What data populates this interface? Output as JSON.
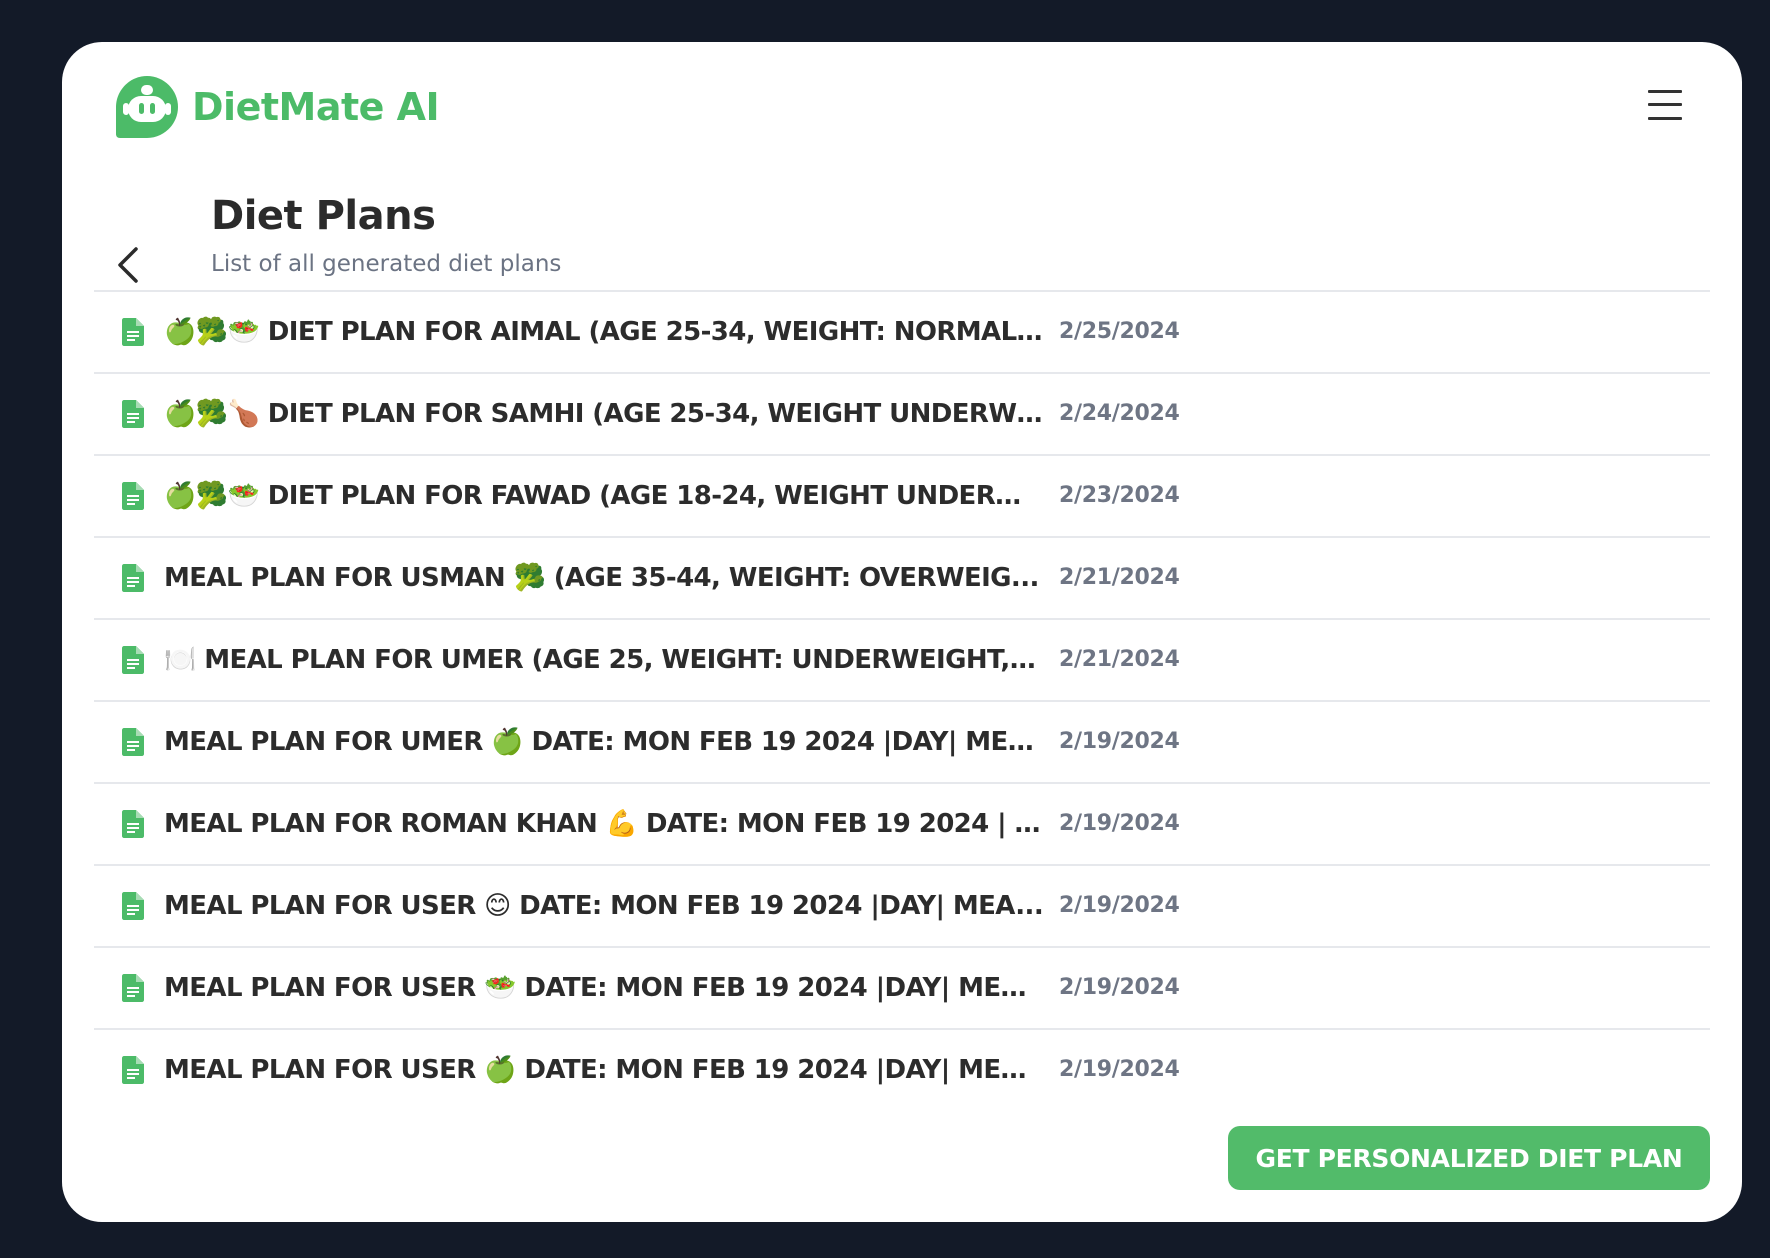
{
  "colors": {
    "brand": "#4cbb68",
    "button": "#52bb6a",
    "background": "#131a28",
    "card": "#ffffff"
  },
  "header": {
    "app_name": "DietMate AI",
    "logo_icon": "robot-chat-icon",
    "menu_icon": "hamburger-menu-icon"
  },
  "page": {
    "back_icon": "chevron-left-icon",
    "title": "Diet Plans",
    "subtitle": "List of all generated diet plans"
  },
  "plans": [
    {
      "title": "🍏🥦🥗 DIET PLAN FOR AIMAL (AGE 25-34, WEIGHT: NORMAL, ...",
      "date": "2/25/2024"
    },
    {
      "title": "🍏🥦🍗 DIET PLAN FOR SAMHI (AGE 25-34, WEIGHT UNDERWE...",
      "date": "2/24/2024"
    },
    {
      "title": "🍏🥦🥗 DIET PLAN FOR FAWAD (AGE 18-24, WEIGHT UNDERW...",
      "date": "2/23/2024"
    },
    {
      "title": "MEAL PLAN FOR USMAN 🥦 (AGE 35-44, WEIGHT: OVERWEIG...",
      "date": "2/21/2024"
    },
    {
      "title": "🍽️ MEAL PLAN FOR UMER (AGE 25, WEIGHT: UNDERWEIGHT, ...",
      "date": "2/21/2024"
    },
    {
      "title": "MEAL PLAN FOR UMER 🍏 DATE: MON FEB 19 2024 |DAY| MEA...",
      "date": "2/19/2024"
    },
    {
      "title": "MEAL PLAN FOR ROMAN KHAN 💪 DATE: MON FEB 19 2024 | D...",
      "date": "2/19/2024"
    },
    {
      "title": "MEAL PLAN FOR USER 😊 DATE: MON FEB 19 2024 |DAY| MEA...",
      "date": "2/19/2024"
    },
    {
      "title": "MEAL PLAN FOR USER 🥗 DATE: MON FEB 19 2024 |DAY| MEA...",
      "date": "2/19/2024"
    },
    {
      "title": "MEAL PLAN FOR USER 🍏 DATE: MON FEB 19 2024 |DAY| MEA...",
      "date": "2/19/2024"
    }
  ],
  "row_icon": "document-icon",
  "cta": {
    "label": "GET PERSONALIZED DIET PLAN"
  }
}
